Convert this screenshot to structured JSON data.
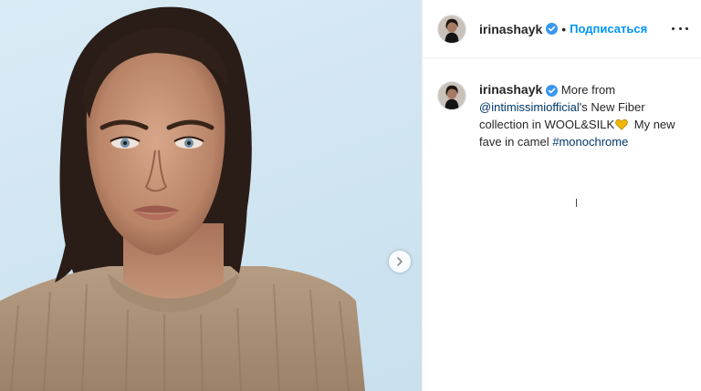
{
  "post": {
    "username": "irinashayk",
    "follow_label": "Подписаться",
    "separator": "•",
    "caption": {
      "username": "irinashayk",
      "text_before": "More from",
      "mention": "@intimissimiofficial",
      "text_after_mention": "'s New Fiber collection in WOOL&SILK",
      "text_after_heart": "My new fave in camel",
      "hashtag": "#monochrome"
    }
  },
  "colors": {
    "accent": "#0095f6",
    "link": "#00376b",
    "verified": "#3897f0",
    "heart": "#f2b705"
  },
  "icons": {
    "verified": "verified-badge-icon",
    "more": "more-options-icon",
    "next": "chevron-right-icon",
    "heart": "yellow-heart-icon"
  }
}
